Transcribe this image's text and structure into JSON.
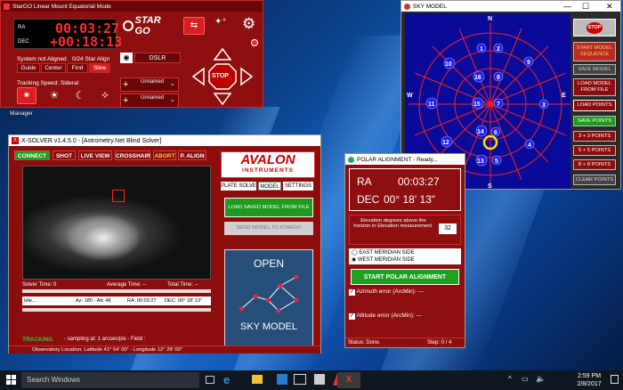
{
  "desktop": {
    "icons": [
      "Manager"
    ]
  },
  "stargo": {
    "title": "StarGO Linear Mount Equatorial Mode",
    "ra_label": "RA",
    "ra_value": "00:03:27",
    "dec_label": "DEC",
    "dec_value": "+00:18:13",
    "logo": "STAR GO",
    "status": "System not Aligned",
    "align": "0/24 Star Align",
    "btn_guide": "Guide",
    "btn_center": "Center",
    "btn_find": "Find",
    "btn_slew": "Slew",
    "camera_label": "DSLR",
    "tracking": "Tracking Speed: Sideral",
    "unnamed1": "Unnamed",
    "unnamed2": "Unnamed",
    "stop": "STOP"
  },
  "xsolver": {
    "title": "X-SOLVER v1.4.5.0 - [Astrometry.Net Blind Solver]",
    "tabs": [
      "CONNECT",
      "SHOT",
      "LIVE VIEW",
      "CROSSHAIR",
      "ABORT",
      "P. ALIGN"
    ],
    "logo_top": "AVALON",
    "logo_bottom": "INSTRUMENTS",
    "subtabs": [
      "PLATE SOLVE",
      "MODEL",
      "SETTINGS"
    ],
    "btn_load": "LOAD SAVED MODEL FROM FILE",
    "btn_send": "SEND MODEL TO STARGO",
    "open_label": "OPEN",
    "sky_model_label": "SKY MODEL",
    "solver_time": "Solver Time: 0",
    "avg_time": "Average Time: --",
    "total_time": "Total Time: --",
    "idle": "Idle...",
    "az": "Az: 180 - Alt: 48",
    "ra": "RA: 00:03:27",
    "dec": "DEC: 00° 18' 13\"",
    "tracking": "TRACKING",
    "sampling": "- sampling at: 1 arcsec/pix - Field :",
    "location": "Observatory Location:  Latitude 41° 54' 00\" - Longitude 12° 29' 00\""
  },
  "polar": {
    "title": "POLAR ALIGNMENT - Ready...",
    "ra_label": "RA",
    "ra_value": "00:03:27",
    "dec_label": "DEC",
    "dec_value": "00° 18' 13\"",
    "elev_text": "Elevation degrees above the horizon in Elevation measurement.",
    "elev_value": "32",
    "east": "EAST MERIDIAN SIDE",
    "west": "WEST MERIDIAN SIDE",
    "start": "START POLAR ALIGNMENT",
    "az_err": "Azimuth  error  (ArcMin): ---",
    "alt_err": "Altitude error  (ArcMin): ---",
    "status": "Status: Done.",
    "step": "Step: 0 / 4"
  },
  "sky": {
    "title": "SKY MODEL",
    "n": "N",
    "s": "S",
    "e": "E",
    "w": "W",
    "stars": [
      "1",
      "2",
      "3",
      "4",
      "5",
      "6",
      "7",
      "8",
      "9",
      "10",
      "11",
      "12",
      "13",
      "14",
      "15",
      "16"
    ],
    "buttons": [
      "STOP",
      "START MODEL SEQUENCE",
      "SAVE MODEL",
      "LOAD MODEL FROM FILE",
      "LOAD POINTS",
      "SAVE POINTS",
      "3 + 3 POINTS",
      "5 + 5 POINTS",
      "8 + 8 POINTS",
      "CLEAR POINTS"
    ]
  },
  "taskbar": {
    "search": "Search Windows",
    "time": "2:59 PM",
    "date": "2/8/2017"
  }
}
